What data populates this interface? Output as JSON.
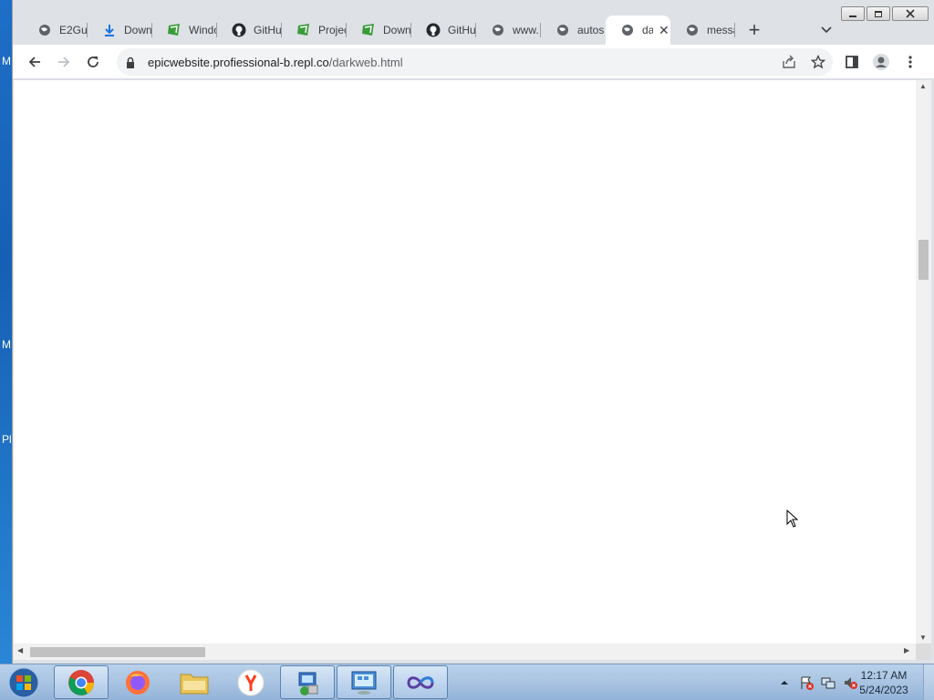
{
  "desktop": {
    "edge_letters": [
      "M",
      "M",
      "Pl"
    ]
  },
  "browser": {
    "tabs": [
      {
        "label": "E2Gu",
        "icon": "globe-icon"
      },
      {
        "label": "Down",
        "icon": "download-icon"
      },
      {
        "label": "Windo",
        "icon": "green-leaf-icon"
      },
      {
        "label": "GitHu",
        "icon": "github-icon"
      },
      {
        "label": "Projec",
        "icon": "green-leaf-icon"
      },
      {
        "label": "Down",
        "icon": "green-leaf-icon"
      },
      {
        "label": "GitHu",
        "icon": "github-icon"
      },
      {
        "label": "www.",
        "icon": "globe-icon"
      },
      {
        "label": "autos",
        "icon": "globe-icon"
      },
      {
        "label": "da",
        "icon": "globe-icon",
        "active": true
      },
      {
        "label": "messa",
        "icon": "globe-icon"
      }
    ],
    "new_tab_label": "+",
    "close_tab_label": "✕",
    "url": {
      "host": "epicwebsite.profiessional-b.repl.co",
      "path": "/darkweb.html"
    }
  },
  "taskbar": {
    "apps": [
      "start-orb",
      "chrome",
      "firefox",
      "file-explorer",
      "yandex",
      "installer",
      "control-panel",
      "visual-studio"
    ],
    "clock_time": "12:17 AM",
    "clock_date": "5/24/2023"
  },
  "colors": {
    "accent": "#1a73e8",
    "tabstrip": "#dee1e6",
    "taskbar": "#a9c4e2"
  }
}
